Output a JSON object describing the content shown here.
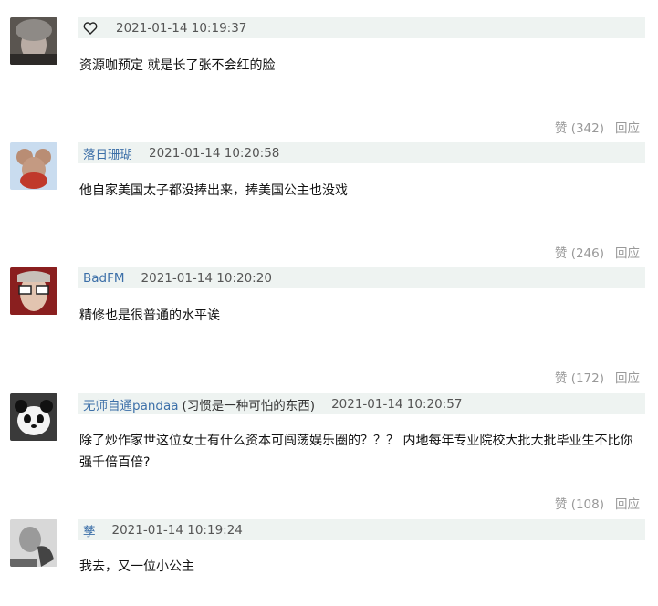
{
  "comments": [
    {
      "user": "",
      "timestamp": "2021-01-14 10:19:37",
      "text": "资源咖预定 就是长了张不会红的脸",
      "like_label": "赞 (342)",
      "reply_label": "回应"
    },
    {
      "user": "落日珊瑚",
      "timestamp": "2021-01-14 10:20:58",
      "text": "他自家美国太子都没捧出来，捧美国公主也没戏",
      "like_label": "赞 (246)",
      "reply_label": "回应"
    },
    {
      "user": "BadFM",
      "timestamp": "2021-01-14 10:20:20",
      "text": "精修也是很普通的水平诶",
      "like_label": "赞 (172)",
      "reply_label": "回应"
    },
    {
      "user": "无师自通pandaa",
      "signature": "(习惯是一种可怕的东西)",
      "timestamp": "2021-01-14 10:20:57",
      "text": "除了炒作家世这位女士有什么资本可闯荡娱乐圈的？？？ 内地每年专业院校大批大批毕业生不比你强千倍百倍?",
      "like_label": "赞 (108)",
      "reply_label": "回应"
    },
    {
      "user": "孳",
      "timestamp": "2021-01-14 10:19:24",
      "text": "我去，又一位小公主"
    }
  ]
}
